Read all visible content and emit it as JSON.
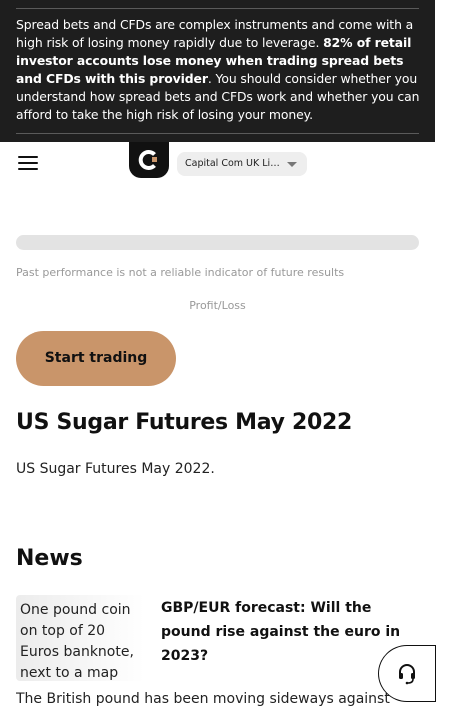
{
  "risk_warning": {
    "part1": "Spread bets and CFDs are complex instruments and come with a high risk of losing money rapidly due to leverage. ",
    "bold": "82% of retail investor accounts lose money when trading spread bets and CFDs with this provider",
    "part2": ". You should consider whether you understand how spread bets and CFDs work and whether you can afford to take the high risk of losing your money."
  },
  "header": {
    "menu_icon": "hamburger-menu-icon",
    "logo_icon": "capital-com-logo-icon",
    "entity_select": {
      "selected": "Capital Com UK Limited"
    }
  },
  "chart_section": {
    "disclaimer": "Past performance is not a reliable indicator of future results",
    "profit_loss_label": "Profit/Loss"
  },
  "cta": {
    "label": "Start trading",
    "color": "#c9956a"
  },
  "instrument": {
    "title": "US Sugar Futures May 2022",
    "description": "US Sugar Futures May 2022."
  },
  "news": {
    "heading": "News",
    "items": [
      {
        "image_alt": "One pound coin on top of 20 Euros banknote, next to a map",
        "headline": "GBP/EUR forecast: Will the pound rise against the euro in 2023?",
        "excerpt": "The British pound has been moving sideways against"
      }
    ]
  },
  "support": {
    "icon": "headset-support-icon"
  }
}
